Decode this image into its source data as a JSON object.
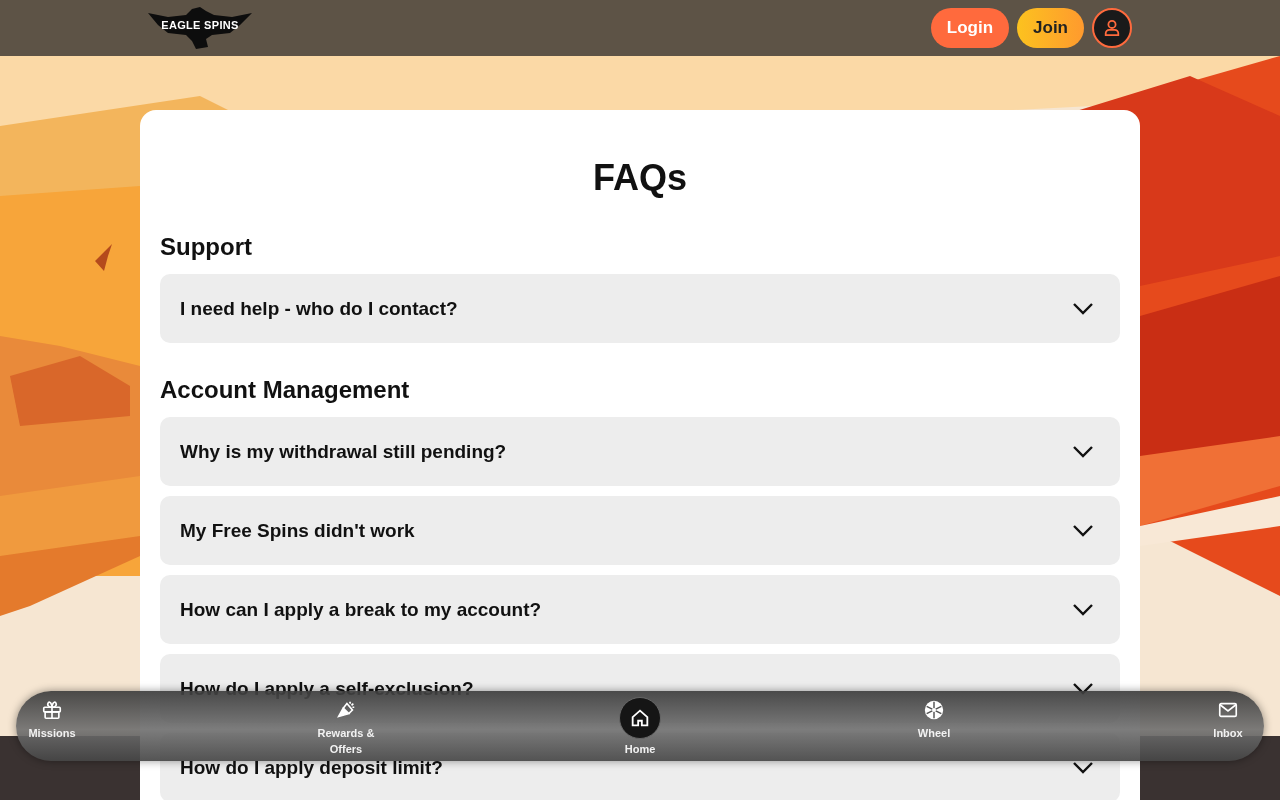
{
  "header": {
    "logo": "EAGLE SPINS",
    "login": "Login",
    "join": "Join"
  },
  "title": "FAQs",
  "sections": [
    {
      "heading": "Support",
      "questions": [
        {
          "text": "I need help - who do I contact?",
          "expanded": false
        }
      ]
    },
    {
      "heading": "Account Management",
      "questions": [
        {
          "text": "Why is my withdrawal still pending?",
          "expanded": false
        },
        {
          "text": "My Free Spins didn't work",
          "expanded": false
        },
        {
          "text": "How can I apply a break to my account?",
          "expanded": false
        },
        {
          "text": "How do I apply a self-exclusion?",
          "expanded": false
        },
        {
          "text": "How do I apply deposit limit?",
          "expanded": false
        }
      ]
    }
  ],
  "nav": [
    {
      "label": "Missions",
      "selected": false
    },
    {
      "label": "Rewards & Offers",
      "selected": false
    },
    {
      "label": "Home",
      "selected": true
    },
    {
      "label": "Wheel",
      "selected": false
    },
    {
      "label": "Inbox",
      "selected": false
    }
  ]
}
